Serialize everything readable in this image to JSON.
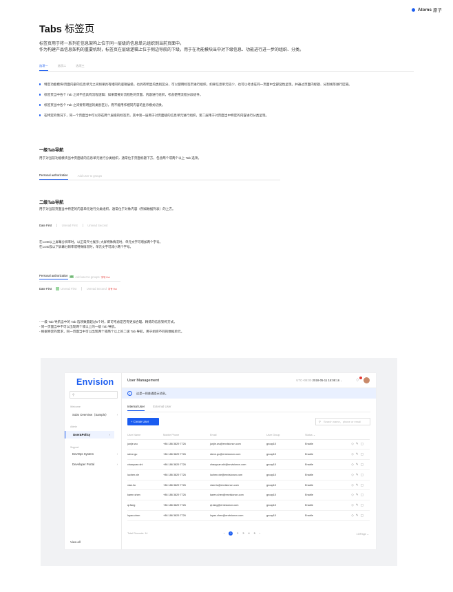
{
  "brand": {
    "name": "Atoms",
    "cn": "原子"
  },
  "title": {
    "en": "Tabs",
    "cn": "标签页"
  },
  "intro": [
    "标签页用于将一系列在信息架构上位于同一层级的信息单元组织到当前页面中。",
    "作为构建产品信息架构的重要机制，标签页在层级逻辑上位于侧边导航的下级，用于在功能模块当中对下级信息、功能进行进一步的组织、分类。"
  ],
  "demo_tabs": [
    "选项一",
    "选项二",
    "选项三"
  ],
  "bullets": [
    "特定功能模块/页面内部的信息单元之间如果具有相同的逻辑层级，也具有明显的类别区分，可以使用标签页进行组织。如果信息单元较少，也可以考虑在同一页面中全部竖性呈现，并通过页面内标题、分割线等进行区隔。",
    "标签页当中各个 Tab 之间不应具有流程逻辑：如果需要对流程性的页面、内容进行组织，考虑使用流程分段组件。",
    "标签页当中各个 Tab 之间要有明显的类别区分，而不能用作相同内容的显示模式切换。",
    "在特定的情况下，同一个页面当中可以存在两个层级的标签页，其中第一层用于对页面级的信息单元进行组织，第二层用于对页面当中特定的内容进行分类呈现。"
  ],
  "level1": {
    "heading": "一级Tab导航",
    "desc": "用于对当前功能模块当中页面级的信息单元进行分类组织，通常位于页面标题下方，包含两个或两个以上 Tab 选项。",
    "tabs": [
      "Personal authorization",
      "Add user to groups"
    ]
  },
  "level2": {
    "heading": "二级Tab导航",
    "desc": "用于对当前页面当中特定的内容单元进行分类组织，通常位于对象内容（例如数据列表）的上方。",
    "tabs": [
      "Date First",
      "Unread First",
      "Unread Second"
    ]
  },
  "screen_notes": [
    "在1440以上屏幕分辨率时，以正常尺寸展示; 大屏特殊情况时，单元文字可增加两个字号。",
    "在1440及以下屏幕分辨率或特殊情况时，单元文字可减小两个字号。"
  ],
  "spec_rows": {
    "row1": [
      "Personal authorization",
      "40",
      "Add user to groups",
      "字号 Hui"
    ],
    "row2": [
      "Date First",
      "Unread First",
      "Unread Second",
      "字号 Hui"
    ]
  },
  "dash_notes": [
    "- 一级 Tab 导航当中的 Tab 选项数量超过5个时，即可考虑是否有更加合理、精炼的信息架构方式。",
    "- 同一页面当中不可以出现两个或以上的一级 Tab 导航。",
    "- 根据特定的需求，同一页面当中可以出现两个或两个以上的二级 Tab 导航，用于组织不同的数据单元。"
  ],
  "app": {
    "logo": "Envision",
    "side_groups": [
      "Welcome",
      "Admin",
      "Support"
    ],
    "side_items": [
      "Solar Overview（Sample）",
      "User&Policy",
      "DevOps System",
      "Developer Portal"
    ],
    "view_all": "View all",
    "page_title": "User Management",
    "timezone": "UTC+08:00",
    "datetime": "2018-05-11  15:08:16",
    "alert": "这是一则普通提示消息。",
    "tabs": [
      "Internal User",
      "External User"
    ],
    "create_button": "+ Create User",
    "search_placeholder": "Search name、phone or email",
    "columns": [
      "User Name",
      "Mobile Phone",
      "Email",
      "User Group",
      "Status"
    ],
    "rows": [
      [
        "junjie.wu",
        "+86  186 3829 7726",
        "junjie.wu@envisioncn.com",
        "group10",
        "Enable"
      ],
      [
        "steve.gu",
        "+86  186 3829 7726",
        "steve.gu@envisioncn.com",
        "group10",
        "Enable"
      ],
      [
        "chaoyuan.shi",
        "+86  186 3829 7726",
        "chaoyuan.shi@envisioncn.com",
        "group10",
        "Enable"
      ],
      [
        "luchen.xie",
        "+86  186 3829 7726",
        "luchen.xie@envisioncn.com",
        "group10",
        "Enable"
      ],
      [
        "xian.liu",
        "+86  186 3829 7726",
        "xian.liu@envisioncn.com",
        "group10",
        "Enable"
      ],
      [
        "karen.shen",
        "+86  186 3829 7726",
        "karen.shen@envisioncn.com",
        "group10",
        "Enable"
      ],
      [
        "qi.fang",
        "+86  186 3829 7726",
        "qi.fang@envisioncn.com",
        "group10",
        "Enable"
      ],
      [
        "luyao.chen",
        "+86  186 3829 7726",
        "luyao.chen@envisioncn.com",
        "group10",
        "Enable"
      ]
    ],
    "total": "Total Records: 14",
    "pages": [
      "1",
      "2",
      "3",
      "4",
      "5"
    ],
    "per_page": "10/Page"
  }
}
